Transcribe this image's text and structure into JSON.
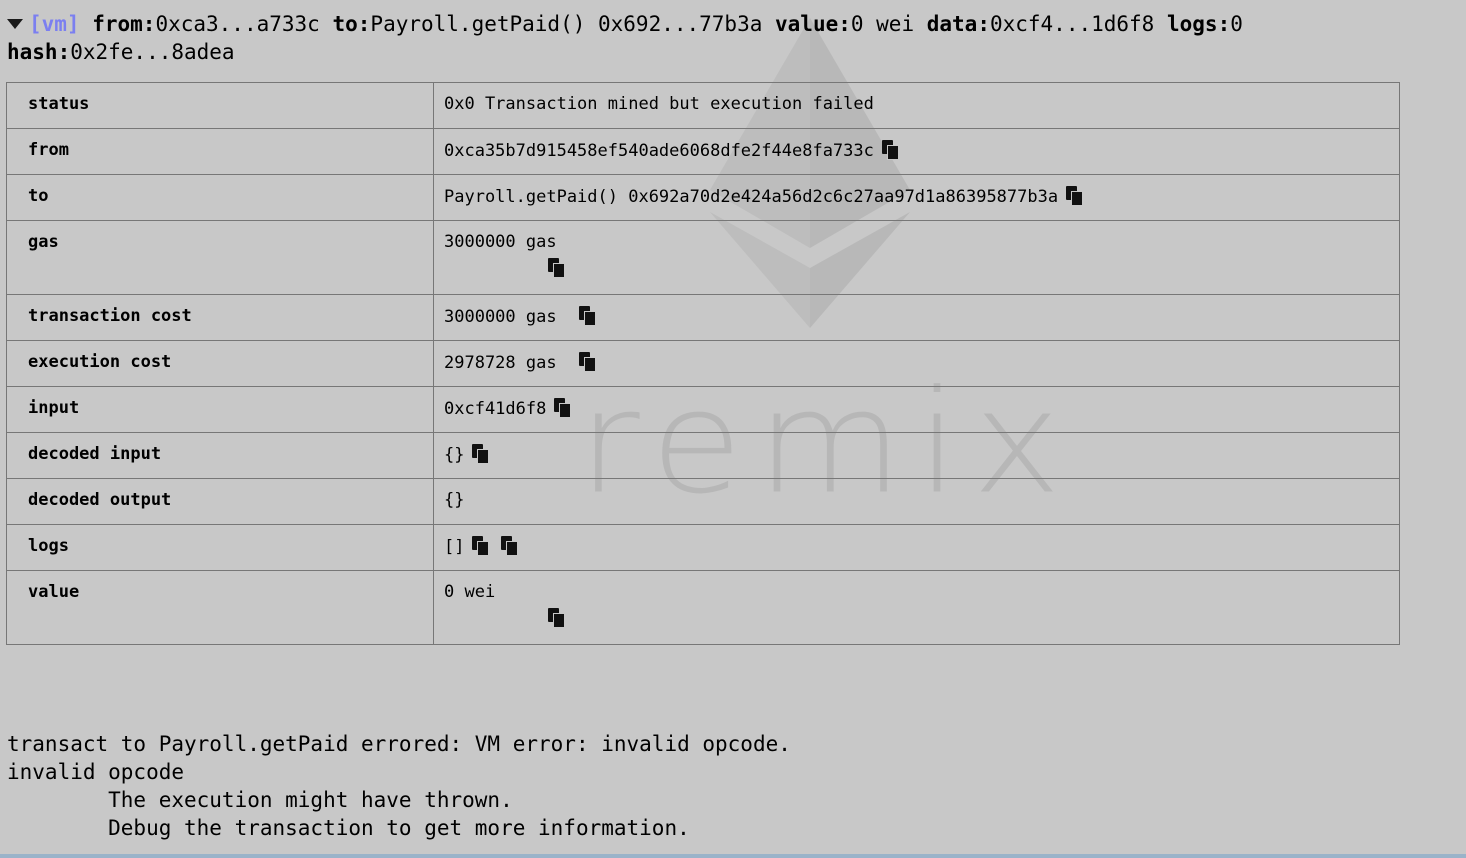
{
  "summary": {
    "vm_tag": "[vm]",
    "from_label": "from:",
    "from_value": "0xca3...a733c",
    "to_label": "to:",
    "to_value": "Payroll.getPaid() 0x692...77b3a",
    "value_label": "value:",
    "value_value": "0 wei",
    "data_label": "data:",
    "data_value": "0xcf4...1d6f8",
    "logs_label": "logs:",
    "logs_value": "0",
    "hash_label": "hash:",
    "hash_value": "0x2fe...8adea"
  },
  "rows": [
    {
      "key": "status",
      "value": "0x0 Transaction mined but execution failed"
    },
    {
      "key": "from",
      "value": "0xca35b7d915458ef540ade6068dfe2f44e8fa733c"
    },
    {
      "key": "to",
      "value": "Payroll.getPaid() 0x692a70d2e424a56d2c6c27aa97d1a86395877b3a"
    },
    {
      "key": "gas",
      "value": "3000000 gas"
    },
    {
      "key": "transaction cost",
      "value": "3000000 gas"
    },
    {
      "key": "execution cost",
      "value": "2978728 gas"
    },
    {
      "key": "input",
      "value": "0xcf41d6f8"
    },
    {
      "key": "decoded input",
      "value": "{}"
    },
    {
      "key": "decoded output",
      "value": "{}"
    },
    {
      "key": "logs",
      "value": "[]"
    },
    {
      "key": "value",
      "value": "0 wei"
    }
  ],
  "error": {
    "line1": "transact to Payroll.getPaid errored: VM error: invalid opcode.",
    "line2": "invalid opcode",
    "line3": "        The execution might have thrown.",
    "line4": "        Debug the transaction to get more information."
  },
  "watermark": {
    "text": "remix",
    "logo_icon": "ethereum-logo-icon"
  },
  "colors": {
    "background": "#c8c8c8",
    "vm_tag": "#7b7ff0",
    "border": "#777777"
  }
}
